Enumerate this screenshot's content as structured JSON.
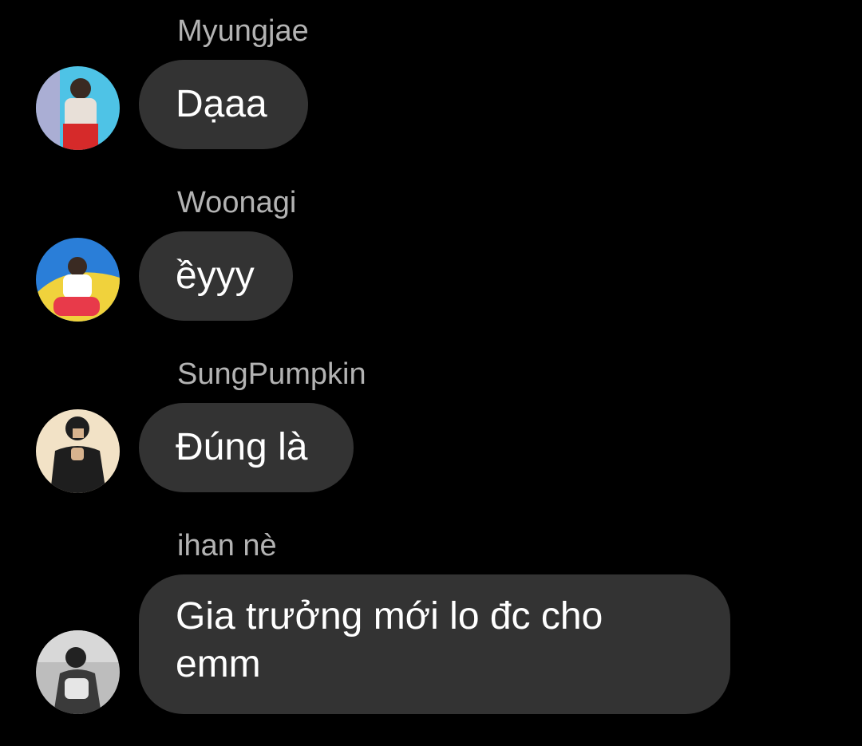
{
  "messages": [
    {
      "sender": "Myungjae",
      "text": "Dạaa",
      "avatar_icon": "profile-photo-icon",
      "avatar_colors": [
        "#4ec3e6",
        "#e8e0d8",
        "#d62a2a"
      ]
    },
    {
      "sender": "Woonagi",
      "text": "ềyyy",
      "avatar_icon": "profile-photo-icon",
      "avatar_colors": [
        "#2a7ed8",
        "#f0d23c",
        "#e83a4a"
      ]
    },
    {
      "sender": "SungPumpkin",
      "text": "Đúng là",
      "avatar_icon": "profile-photo-icon",
      "avatar_colors": [
        "#f2e2c6",
        "#1e1e1e",
        "#d8b38e"
      ]
    },
    {
      "sender": "ihan nè",
      "text_lines": [
        "Gia trưởng mới lo đc cho",
        "emm"
      ],
      "avatar_icon": "profile-photo-icon",
      "avatar_colors": [
        "#bdbdbd",
        "#3a3a3a",
        "#e6e6e6"
      ]
    }
  ],
  "colors": {
    "background": "#000000",
    "bubble": "#333333",
    "sender_name": "#b3b3b3",
    "message_text": "#ffffff"
  }
}
